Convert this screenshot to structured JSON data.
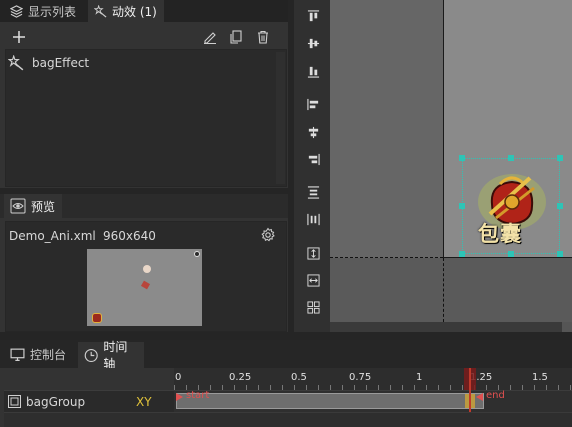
{
  "tabs": [
    {
      "label": "显示列表",
      "icon": "layers-icon"
    },
    {
      "label": "动效 (1)",
      "icon": "magic-wand-icon"
    }
  ],
  "effects_panel": {
    "items": [
      {
        "label": "bagEffect",
        "icon": "magic-wand-icon"
      }
    ]
  },
  "preview": {
    "tab_label": "预览",
    "file_name": "Demo_Ani.xml",
    "resolution": "960x640"
  },
  "bottom_tabs": [
    {
      "label": "控制台",
      "icon": "monitor-icon"
    },
    {
      "label": "时间轴",
      "icon": "clock-icon"
    }
  ],
  "timeline": {
    "ruler": [
      "0",
      "0.25",
      "0.5",
      "0.75",
      "1",
      "1.25",
      "1.5"
    ],
    "track_name": "bagGroup",
    "track_property": "XY",
    "start_label": "start",
    "end_label": "end"
  },
  "sprite": {
    "caption": "包囊"
  },
  "colors": {
    "accent_red": "#c0392b",
    "timeline_label_yellow": "#e0c23a",
    "selection_cyan": "#2ec4b6"
  }
}
